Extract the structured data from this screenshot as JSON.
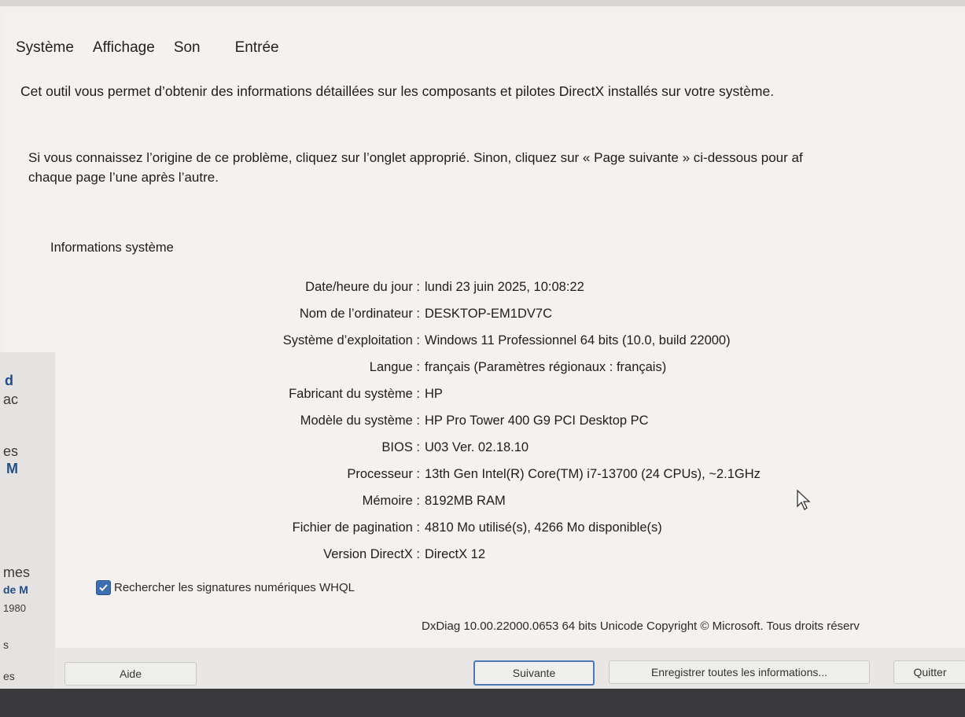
{
  "tabs": [
    "Système",
    "Affichage",
    "Son",
    "Entrée"
  ],
  "intro_text": "Cet outil vous permet d’obtenir des informations détaillées sur les composants et pilotes DirectX installés sur votre système.",
  "hint_line1": "Si vous connaissez l’origine de ce problème, cliquez sur l’onglet approprié. Sinon, cliquez sur « Page suivante » ci-dessous pour af",
  "hint_line2": "chaque page l’une après l’autre.",
  "group_title": "Informations système",
  "system_info": [
    {
      "label": "Date/heure du jour :",
      "value": "lundi 23 juin 2025, 10:08:22"
    },
    {
      "label": "Nom de l’ordinateur :",
      "value": "DESKTOP-EM1DV7C"
    },
    {
      "label": "Système d’exploitation :",
      "value": "Windows 11 Professionnel 64 bits (10.0, build 22000)"
    },
    {
      "label": "Langue :",
      "value": "français (Paramètres régionaux : français)"
    },
    {
      "label": "Fabricant du système :",
      "value": "HP"
    },
    {
      "label": "Modèle du système :",
      "value": "HP Pro Tower 400 G9 PCI Desktop PC"
    },
    {
      "label": "BIOS :",
      "value": "U03 Ver. 02.18.10"
    },
    {
      "label": "Processeur :",
      "value": "13th Gen Intel(R) Core(TM) i7-13700 (24 CPUs), ~2.1GHz"
    },
    {
      "label": "Mémoire :",
      "value": "8192MB RAM"
    },
    {
      "label": "Fichier de pagination :",
      "value": "4810 Mo utilisé(s), 4266 Mo disponible(s)"
    },
    {
      "label": "Version DirectX :",
      "value": "DirectX 12"
    }
  ],
  "whql_checkbox": {
    "label": "Rechercher les signatures numériques WHQL",
    "checked": true
  },
  "copyright": "DxDiag 10.00.22000.0653 64 bits Unicode Copyright © Microsoft. Tous droits réserv",
  "buttons": {
    "help": "Aide",
    "next": "Suivante",
    "save_all": "Enregistrer toutes les informations...",
    "quit": "Quitter"
  },
  "background_fragments": [
    "d",
    "ac",
    "es",
    "M",
    "mes",
    "de M",
    "1980",
    "s",
    "es"
  ],
  "colors": {
    "accent": "#3d6fb0",
    "window_bg": "#f3f2f0",
    "bottom_strip": "#3a3a3c"
  }
}
